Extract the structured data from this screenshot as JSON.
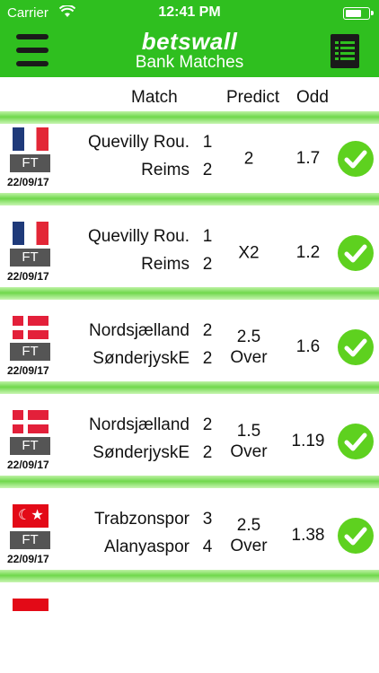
{
  "status": {
    "carrier": "Carrier",
    "time": "12:41 PM"
  },
  "header": {
    "brand": "betswall",
    "subtitle": "Bank Matches"
  },
  "columns": {
    "match": "Match",
    "predict": "Predict",
    "odd": "Odd"
  },
  "rows": [
    {
      "flag": "france",
      "status": "FT",
      "date": "22/09/17",
      "home": "Quevilly Rou.",
      "away": "Reims",
      "home_score": "1",
      "away_score": "2",
      "predict_line1": "2",
      "predict_line2": "",
      "odd": "1.7"
    },
    {
      "flag": "france",
      "status": "FT",
      "date": "22/09/17",
      "home": "Quevilly Rou.",
      "away": "Reims",
      "home_score": "1",
      "away_score": "2",
      "predict_line1": "X2",
      "predict_line2": "",
      "odd": "1.2"
    },
    {
      "flag": "denmark",
      "status": "FT",
      "date": "22/09/17",
      "home": "Nordsjælland",
      "away": "SønderjyskE",
      "home_score": "2",
      "away_score": "2",
      "predict_line1": "2.5",
      "predict_line2": "Over",
      "odd": "1.6"
    },
    {
      "flag": "denmark",
      "status": "FT",
      "date": "22/09/17",
      "home": "Nordsjælland",
      "away": "SønderjyskE",
      "home_score": "2",
      "away_score": "2",
      "predict_line1": "1.5",
      "predict_line2": "Over",
      "odd": "1.19"
    },
    {
      "flag": "turkey",
      "status": "FT",
      "date": "22/09/17",
      "home": "Trabzonspor",
      "away": "Alanyaspor",
      "home_score": "3",
      "away_score": "4",
      "predict_line1": "2.5",
      "predict_line2": "Over",
      "odd": "1.38"
    }
  ],
  "icons": {
    "menu": "hamburger-menu-icon",
    "list": "list-document-icon",
    "check": "green-check-circle-icon",
    "flag_france": "france-flag-icon",
    "flag_denmark": "denmark-flag-icon",
    "flag_turkey": "turkey-flag-icon"
  },
  "colors": {
    "brand_green": "#2fbf1f",
    "check_green": "#5ed11f",
    "row_sep_green": "#70d84c"
  }
}
